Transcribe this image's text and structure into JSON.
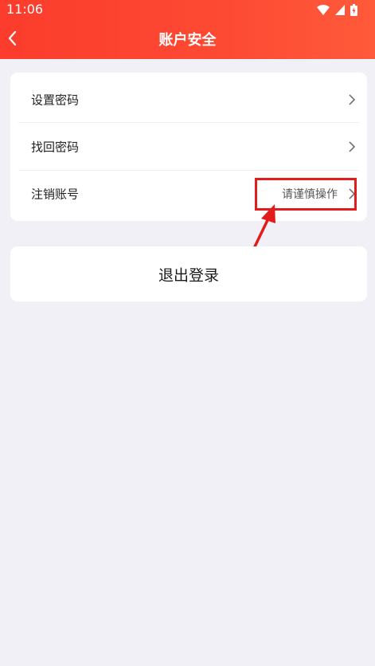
{
  "status_bar": {
    "time": "11:06",
    "icons": [
      "wifi-icon",
      "cellular-signal-icon",
      "battery-icon"
    ]
  },
  "header": {
    "title": "账户安全",
    "back_icon": "chevron-left-icon",
    "accent_color": "#fc3c2c"
  },
  "settings": {
    "items": [
      {
        "label": "设置密码",
        "hint": ""
      },
      {
        "label": "找回密码",
        "hint": ""
      },
      {
        "label": "注销账号",
        "hint": "请谨慎操作"
      }
    ],
    "chevron_icon": "chevron-right-icon"
  },
  "logout": {
    "label": "退出登录"
  },
  "annotation": {
    "color": "#e21b1b",
    "type": "red-box-with-arrow"
  }
}
